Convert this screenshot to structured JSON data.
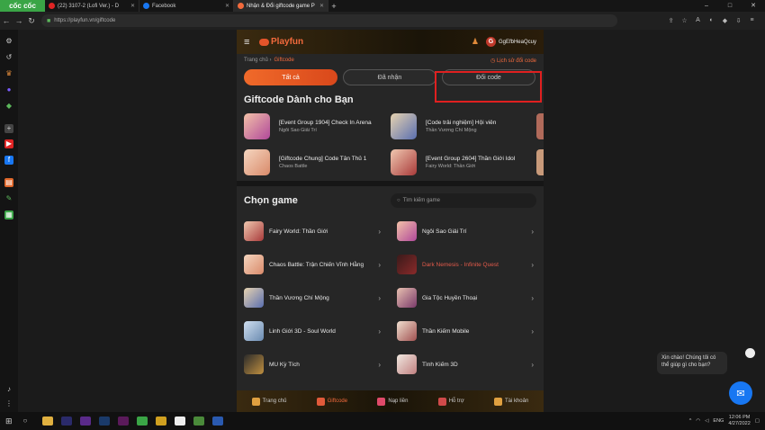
{
  "browser": {
    "brand": "cốc cốc",
    "tabs": [
      {
        "title": "(22) 3107-2 (Lofi Ver.) - D",
        "color": "#e02424"
      },
      {
        "title": "Facebook",
        "color": "#1877f2"
      },
      {
        "title": "Nhận & Đổi giftcode game P",
        "color": "#f26a3c"
      }
    ],
    "url": "https://playfun.vn/giftcode",
    "window_controls": [
      "‒",
      "□",
      "✕"
    ]
  },
  "header": {
    "logo": "Playfun",
    "avatar_letter": "G",
    "username": "GgEfbHeaQcuy"
  },
  "breadcrumb": {
    "home": "Trang chủ",
    "current": "Giftcode",
    "history": "Lịch sử đổi code"
  },
  "tabs": {
    "all": "Tất cả",
    "received": "Đã nhận",
    "redeem": "Đổi code"
  },
  "giftcode": {
    "title": "Giftcode Dành cho Bạn",
    "items": [
      {
        "title": "[Event Group 1904] Check In Arena",
        "game": "Ngôi Sao Giải Trí"
      },
      {
        "title": "[Code trải nghiệm] Hội viên",
        "game": "Thần Vương Chí Mộng"
      },
      {
        "title": "[Giftcode Chung] Code Tân Thủ 1",
        "game": "Chaos Battle"
      },
      {
        "title": "[Event Group 2604] Thần Giới Idol",
        "game": "Fairy World: Thần Giới"
      }
    ]
  },
  "games": {
    "title": "Chọn game",
    "search_placeholder": "Tìm kiếm game",
    "items": [
      {
        "name": "Fairy World: Thần Giới"
      },
      {
        "name": "Ngôi Sao Giải Trí"
      },
      {
        "name": "Chaos Battle: Trận Chiến Vĩnh Hằng"
      },
      {
        "name": "Dark Nemesis - Infinite Quest"
      },
      {
        "name": "Thần Vương Chí Mộng"
      },
      {
        "name": "Gia Tộc Huyền Thoại"
      },
      {
        "name": "Linh Giới 3D - Soul World"
      },
      {
        "name": "Thần Kiếm Mobile"
      },
      {
        "name": "MU Kỳ Tích"
      },
      {
        "name": "Tình Kiếm 3D"
      }
    ]
  },
  "bottom_nav": [
    "Trang chủ",
    "Giftcode",
    "Nạp liền",
    "Hỗ trợ",
    "Tài khoản"
  ],
  "chat": {
    "message": "Xin chào! Chúng tôi có thể giúp gì cho bạn?"
  },
  "taskbar": {
    "lang": "ENG",
    "time": "12:06 PM",
    "date": "4/27/2022"
  }
}
